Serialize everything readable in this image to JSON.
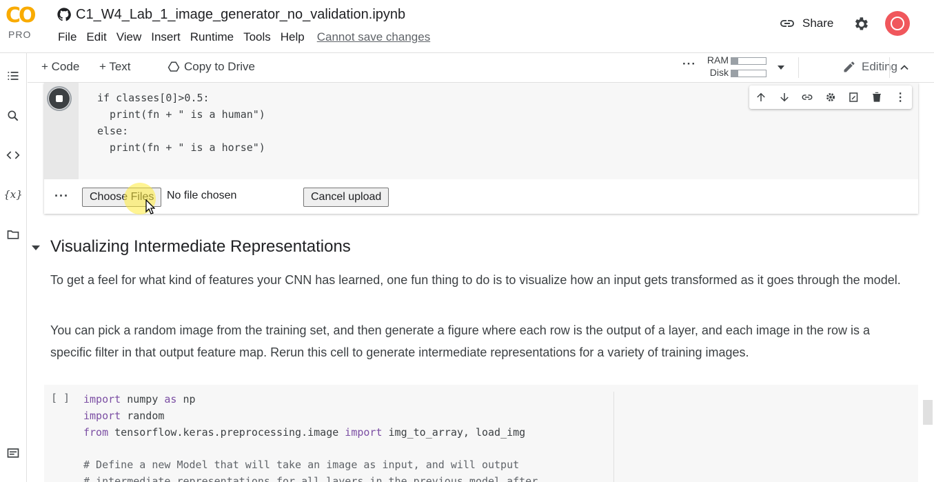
{
  "app": {
    "logo_text": "CO",
    "plan": "PRO",
    "notebook_name": "C1_W4_Lab_1_image_generator_no_validation.ipynb",
    "menu": [
      "File",
      "Edit",
      "View",
      "Insert",
      "Runtime",
      "Tools",
      "Help"
    ],
    "save_status": "Cannot save changes",
    "share_label": "Share"
  },
  "toolbar": {
    "code_label": "+ Code",
    "text_label": "+ Text",
    "copy_label": "Copy to Drive",
    "ram_label": "RAM",
    "disk_label": "Disk",
    "ram_fill": 0.2,
    "disk_fill": 0.2,
    "editing_label": "Editing"
  },
  "cell1": {
    "code_lines": [
      "if classes[0]>0.5:",
      "  print(fn + \" is a human\")",
      "else:",
      "  print(fn + \" is a horse\")"
    ],
    "choose_files_label": "Choose Files",
    "no_file_text": "No file chosen",
    "cancel_label": "Cancel upload"
  },
  "section": {
    "title": "Visualizing Intermediate Representations",
    "para1": "To get a feel for what kind of features your CNN has learned, one fun thing to do is to visualize how an input gets transformed as it goes through the model.",
    "para2": "You can pick a random image from the training set, and then generate a figure where each row is the output of a layer, and each image in the row is a specific filter in that output feature map. Rerun this cell to generate intermediate representations for a variety of training images."
  },
  "cell2": {
    "bracket": "[ ]",
    "line1_kw": "import",
    "line1_rest": " numpy ",
    "line1_kw2": "as",
    "line1_rest2": " np",
    "line2_kw": "import",
    "line2_rest": " random",
    "line3_kw": "from",
    "line3_rest": " tensorflow.keras.preprocessing.image ",
    "line3_kw2": "import",
    "line3_rest2": " img_to_array, load_img",
    "line4": "# Define a new Model that will take an image as input, and will output",
    "line5": "# intermediate representations for all layers in the previous model after"
  },
  "colors": {
    "accent": "#f9ab00",
    "keyword": "#7b4ea3"
  }
}
